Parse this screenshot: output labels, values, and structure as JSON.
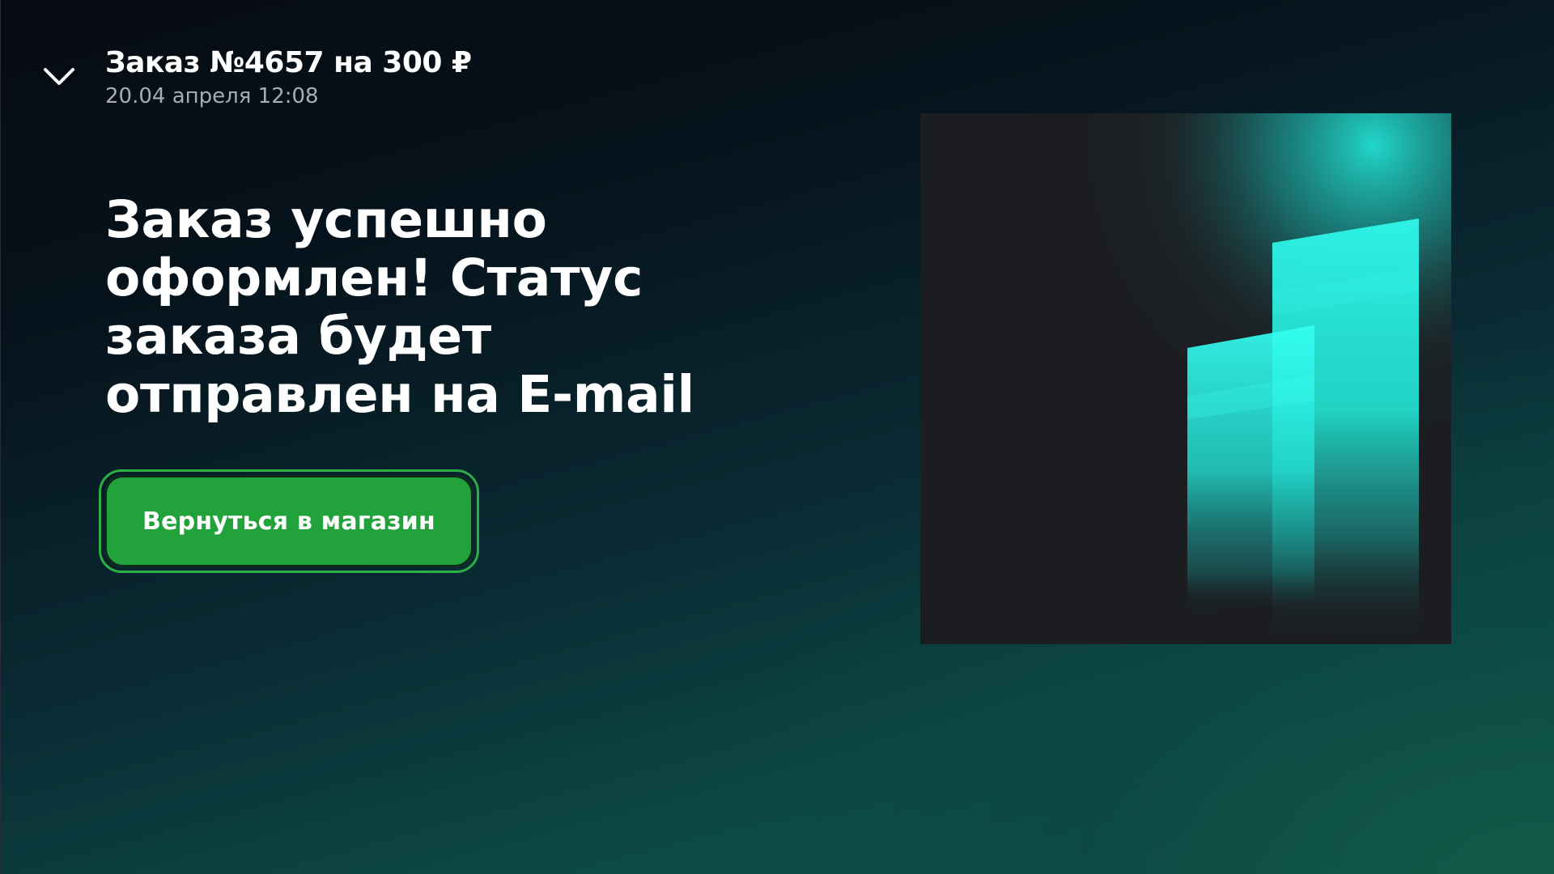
{
  "header": {
    "collapse_icon": "chevron-down-icon",
    "order_title": "Заказ №4657 на 300 ₽",
    "order_date": "20.04 апреля 12:08"
  },
  "main": {
    "message": "Заказ успешно оформлен! Статус заказа будет отправлен на E-mail",
    "back_button_label": "Вернуться в магазин"
  },
  "illustration": {
    "name": "bar-chart-illustration"
  },
  "colors": {
    "button": "#22a23a",
    "accent": "#2cf5e6",
    "card_background": "#1b1d21"
  }
}
